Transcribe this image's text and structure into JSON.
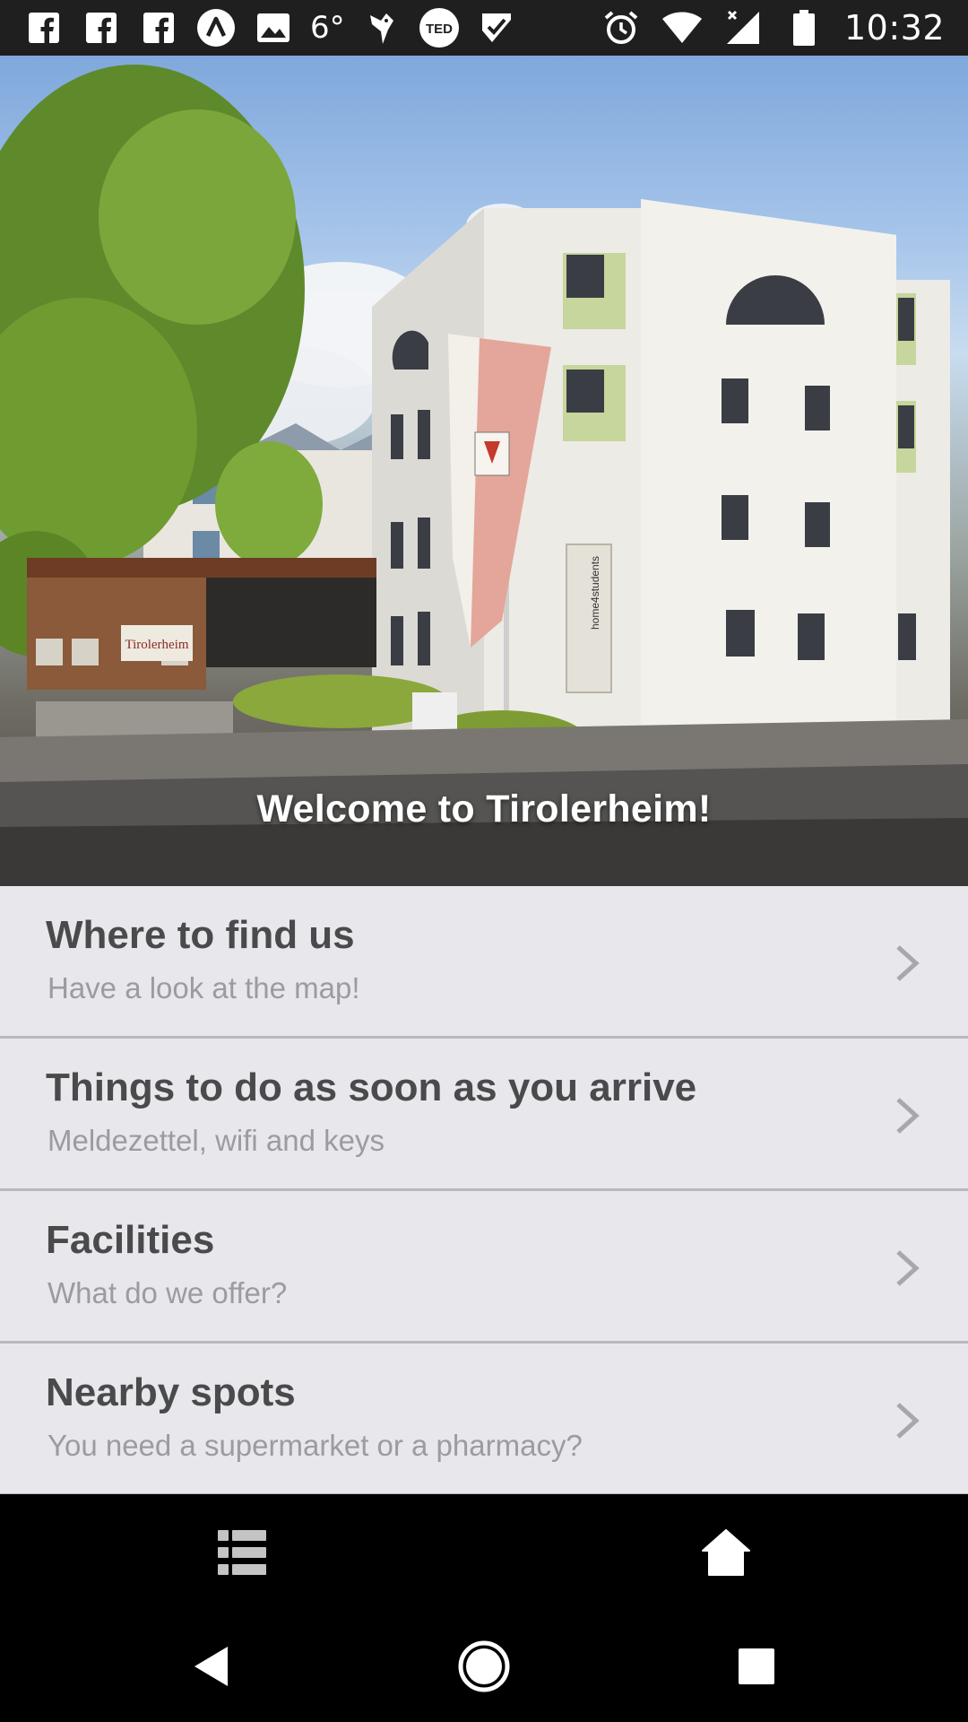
{
  "status_bar": {
    "left_icons": [
      "facebook-icon",
      "facebook-icon",
      "facebook-icon",
      "arc-icon",
      "image-icon"
    ],
    "temperature": "6°",
    "extra_icons": [
      "bird-icon",
      "ted-icon",
      "checkmark-icon"
    ],
    "right_icons": [
      "alarm-icon",
      "wifi-icon",
      "signal-icon",
      "battery-icon"
    ],
    "time": "10:32"
  },
  "hero": {
    "title": "Welcome to Tirolerheim!",
    "sign_text": "Tirolerheim",
    "building_label": "home4students"
  },
  "menu": {
    "items": [
      {
        "title": "Where to find us",
        "subtitle": "Have a look at the map!"
      },
      {
        "title": "Things to do as soon as you arrive",
        "subtitle": "Meldezettel, wifi and keys"
      },
      {
        "title": "Facilities",
        "subtitle": "What do we offer?"
      },
      {
        "title": "Nearby spots",
        "subtitle": "You need a supermarket or a pharmacy?"
      }
    ]
  },
  "tabbar": {
    "tabs": [
      {
        "icon": "list-icon"
      },
      {
        "icon": "home-icon"
      }
    ]
  },
  "navbar": {
    "buttons": [
      "back-icon",
      "home-circle-icon",
      "recents-icon"
    ]
  },
  "colors": {
    "status_bar_bg": "#1f1f1f",
    "menu_bg": "#e8e7ec",
    "title_text": "#4a4a4c",
    "subtitle_text": "#9c9ba0",
    "divider": "#b9b8bd",
    "chevron": "#a8a7ac"
  }
}
